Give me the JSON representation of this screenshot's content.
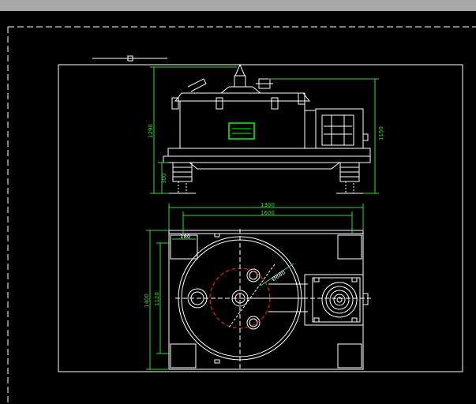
{
  "titlebar": {
    "background": "#a8a8a8"
  },
  "colors": {
    "background": "#000000",
    "line": "#ffffff",
    "dimension": "#3ad83a",
    "centerline": "#ff2a2a",
    "highlight": "#00ff00"
  },
  "drawing": {
    "front_view": {
      "dim_overall_height": "1290",
      "dim_side_height": "1150",
      "dim_base_height": "300"
    },
    "plan_view": {
      "dim_width_outer": "1300",
      "dim_width_inner": "1600",
      "dim_height_outer": "1400",
      "dim_height_inner": "1120",
      "dim_corner": "180",
      "dim_radius": "Ø880"
    }
  }
}
